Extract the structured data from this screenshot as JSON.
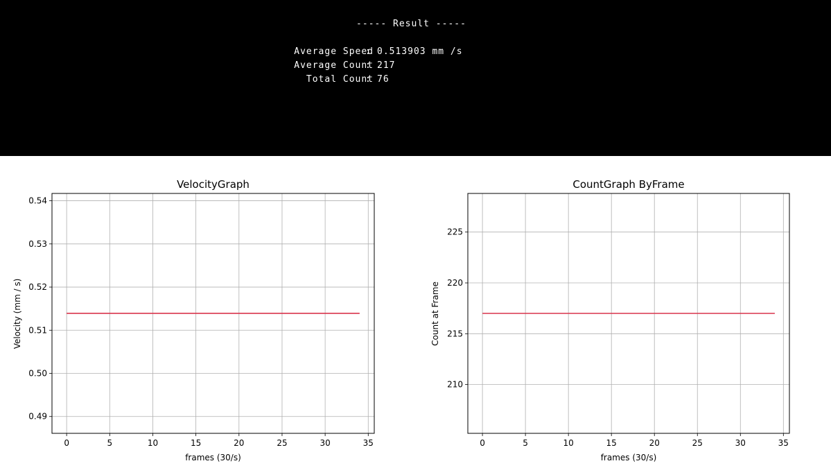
{
  "result": {
    "heading": "----- Result -----",
    "rows": [
      {
        "label": "Average Speed",
        "sep": ":",
        "value": "0.513903 mm /s"
      },
      {
        "label": "Average Count",
        "sep": ":",
        "value": "217"
      },
      {
        "label": "Total Count",
        "sep": ":",
        "value": "76"
      }
    ]
  },
  "chart_data": [
    {
      "type": "line",
      "title": "VelocityGraph",
      "xlabel": "frames (30/s)",
      "ylabel": "Velocity (mm / s)",
      "xlim": [
        -1.7,
        35.7
      ],
      "ylim": [
        0.4861,
        0.5417
      ],
      "xticks": [
        0,
        5,
        10,
        15,
        20,
        25,
        30,
        35
      ],
      "yticks": [
        0.49,
        0.5,
        0.51,
        0.52,
        0.53,
        0.54
      ],
      "ytick_labels": [
        "0.49",
        "0.50",
        "0.51",
        "0.52",
        "0.53",
        "0.54"
      ],
      "grid": true,
      "series": [
        {
          "color": "#d9344b",
          "x": [
            0,
            34
          ],
          "y": [
            0.513903,
            0.513903
          ]
        }
      ]
    },
    {
      "type": "line",
      "title": "CountGraph ByFrame",
      "xlabel": "frames (30/s)",
      "ylabel": "Count at Frame",
      "xlim": [
        -1.7,
        35.7
      ],
      "ylim": [
        205.2,
        228.8
      ],
      "xticks": [
        0,
        5,
        10,
        15,
        20,
        25,
        30,
        35
      ],
      "yticks": [
        210,
        215,
        220,
        225
      ],
      "ytick_labels": [
        "210",
        "215",
        "220",
        "225"
      ],
      "grid": true,
      "series": [
        {
          "color": "#d9344b",
          "x": [
            0,
            34
          ],
          "y": [
            217,
            217
          ]
        }
      ]
    }
  ]
}
